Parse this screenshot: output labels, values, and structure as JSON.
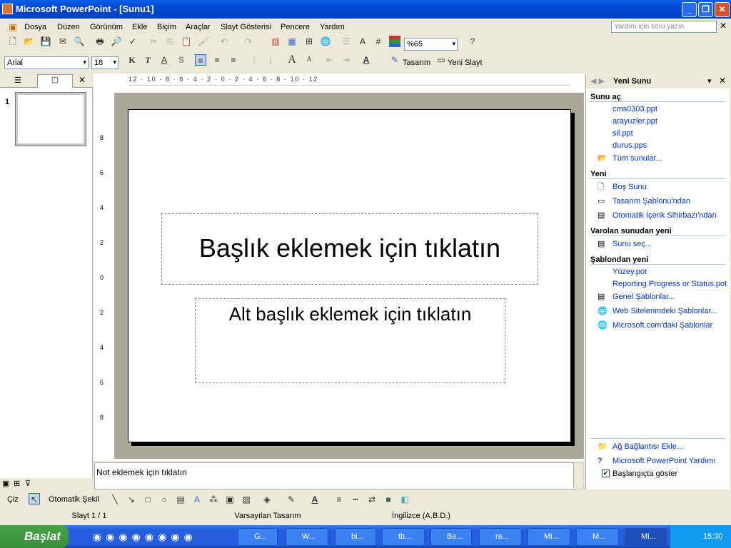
{
  "window": {
    "title": "Microsoft PowerPoint - [Sunu1]"
  },
  "menu": [
    "Dosya",
    "Düzen",
    "Görünüm",
    "Ekle",
    "Biçim",
    "Araçlar",
    "Slayt Gösterisi",
    "Pencere",
    "Yardım"
  ],
  "help_box": {
    "placeholder": "Yardım için soru yazın"
  },
  "toolbar": {
    "zoom": "%65",
    "font": "Arial",
    "size": "18",
    "design": "Tasarım",
    "new_slide": "Yeni Slayt",
    "bold": "K",
    "italic": "T",
    "underline": "A",
    "shadow": "S"
  },
  "ruler": {
    "h": "12 · 10 · 8 · 6 · 4 · 2 · 0 · 2 · 4 · 6 · 8 · 10 · 12",
    "v": [
      "8",
      "6",
      "4",
      "2",
      "0",
      "2",
      "4",
      "6",
      "8"
    ]
  },
  "left_pane": {
    "slide_number": "1"
  },
  "slide": {
    "title_placeholder": "Başlık eklemek için tıklatın",
    "subtitle_placeholder": "Alt başlık eklemek için tıklatın"
  },
  "notes": {
    "placeholder": "Not eklemek için tıklatın"
  },
  "task_pane": {
    "title": "Yeni Sunu",
    "open_header": "Sunu aç",
    "open_files": [
      "cms0303.ppt",
      "arayuzler.ppt",
      "sil.ppt",
      "durus.pps"
    ],
    "more": "Tüm sunular...",
    "new_header": "Yeni",
    "new_items": [
      "Boş Sunu",
      "Tasarım Şablonu'ndan",
      "Otomatik İçerik Sihirbazı'ndan"
    ],
    "existing_header": "Varolan sunudan yeni",
    "existing_item": "Sunu seç...",
    "template_header": "Şablondan yeni",
    "template_items": [
      "Yüzey.pot",
      "Reporting Progress or Status.pot",
      "Genel Şablonlar...",
      "Web Sitelerimdeki Şablonlar...",
      "Microsoft.com'daki Şablonlar"
    ],
    "add_link": "Ağ Bağlantısı Ekle...",
    "help": "Microsoft PowerPoint Yardımı",
    "show_at_startup": "Başlangıçta göster",
    "show_checked": true
  },
  "drawing": {
    "draw": "Çiz",
    "autoshapes": "Otomatik Şekil"
  },
  "status": {
    "slide": "Slayt 1 / 1",
    "design": "Varsayılan Tasarım",
    "language": "İngilizce (A.B.D.)"
  },
  "taskbar": {
    "start": "Başlat",
    "buttons": [
      "G...",
      "W...",
      "bi...",
      "tb...",
      "Be...",
      "re...",
      "Mi...",
      "M...",
      "Mi..."
    ],
    "clock": "15:30"
  }
}
